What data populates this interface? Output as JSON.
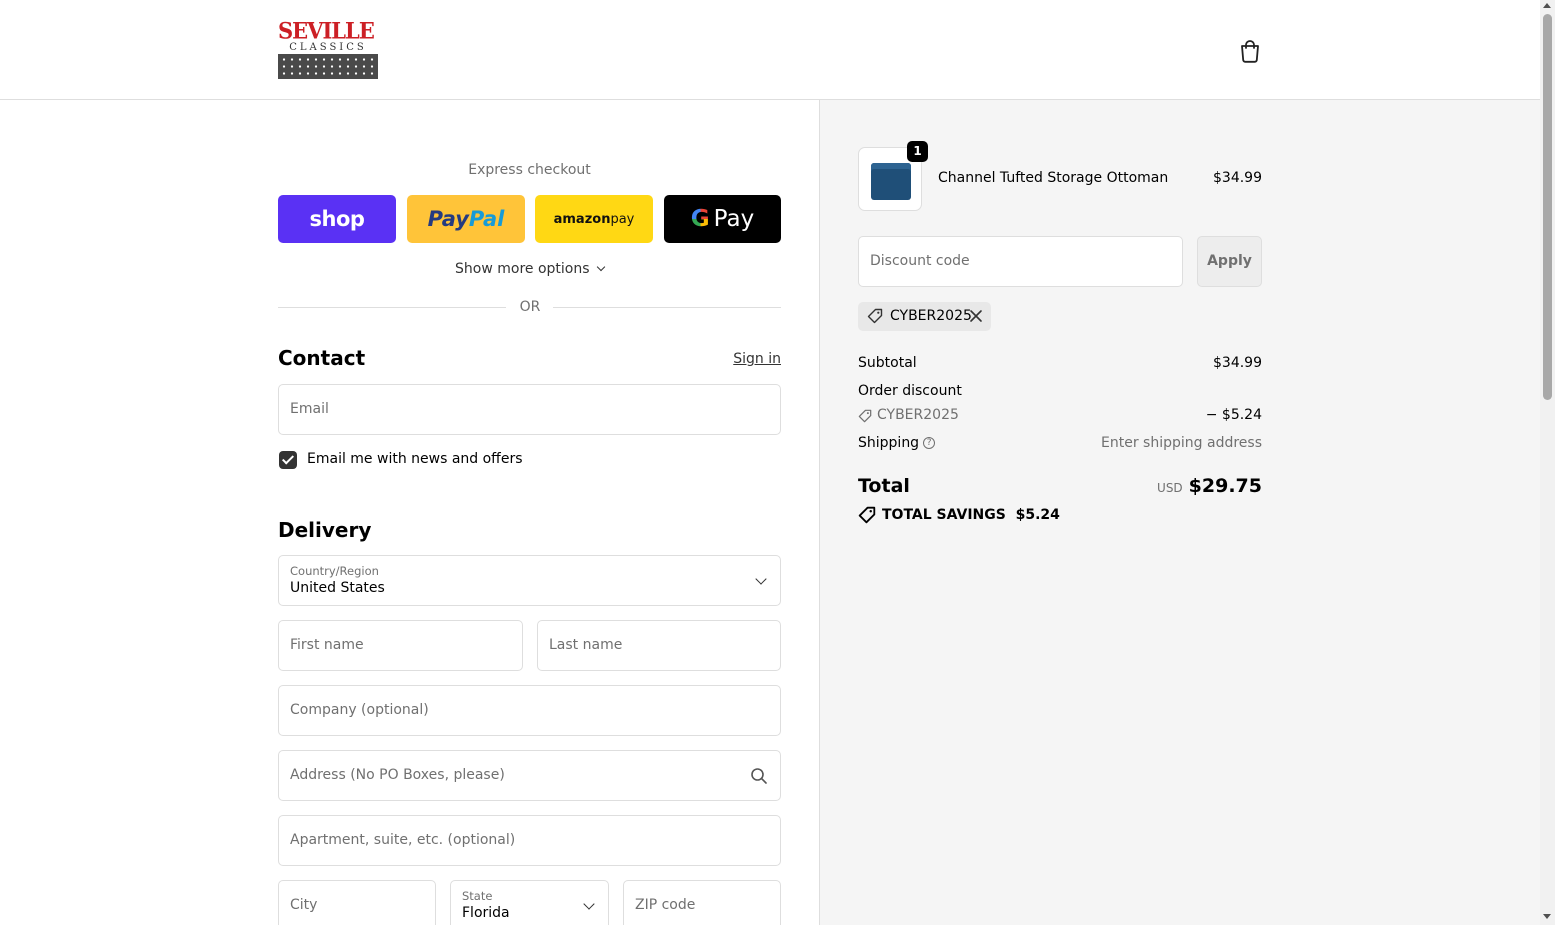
{
  "header": {
    "logo_text": "SEVILLE",
    "logo_subtext": "CLASSICS",
    "cart_icon": "shopping-bag-icon"
  },
  "express": {
    "title": "Express checkout",
    "buttons": {
      "shop": "shop",
      "paypal_1": "Pay",
      "paypal_2": "Pal",
      "amazon_1": "amazon",
      "amazon_2": " pay",
      "gpay_g": "G",
      "gpay_text": "Pay"
    },
    "more_options": "Show more options",
    "or": "OR"
  },
  "contact": {
    "title": "Contact",
    "sign_in": "Sign in",
    "email_placeholder": "Email",
    "newsletter_label": "Email me with news and offers",
    "newsletter_checked": true
  },
  "delivery": {
    "title": "Delivery",
    "country_label": "Country/Region",
    "country_value": "United States",
    "first_name": "First name",
    "last_name": "Last name",
    "company": "Company (optional)",
    "address": "Address (No PO Boxes, please)",
    "apartment": "Apartment, suite, etc. (optional)",
    "city": "City",
    "state_label": "State",
    "state_value": "Florida",
    "zip": "ZIP code"
  },
  "summary": {
    "product": {
      "name": "Channel Tufted Storage Ottoman",
      "price": "$34.99",
      "quantity": "1"
    },
    "discount_placeholder": "Discount code",
    "apply_label": "Apply",
    "applied_code": "CYBER2025",
    "subtotal_label": "Subtotal",
    "subtotal_value": "$34.99",
    "order_discount_label": "Order discount",
    "discount_code": "CYBER2025",
    "discount_value": "− $5.24",
    "shipping_label": "Shipping",
    "shipping_help": "?",
    "shipping_value": "Enter shipping address",
    "total_label": "Total",
    "currency": "USD",
    "total_value": "$29.75",
    "savings_label": "TOTAL SAVINGS",
    "savings_value": "$5.24"
  },
  "colors": {
    "shop_purple": "#5a31f4",
    "paypal_yellow": "#ffc439",
    "amazon_yellow": "#ffd814",
    "logo_red": "#cc1f25",
    "summary_bg": "#f5f5f5"
  }
}
